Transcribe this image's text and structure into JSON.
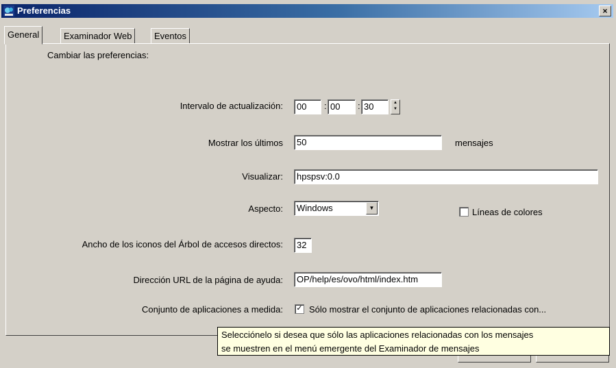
{
  "window": {
    "title": "Preferencias",
    "close_label": "×"
  },
  "tabs": [
    {
      "label": "General",
      "active": true
    },
    {
      "label": "Examinador Web",
      "active": false
    },
    {
      "label": "Eventos",
      "active": false
    }
  ],
  "general": {
    "heading": "Cambiar las preferencias:",
    "interval": {
      "label": "Intervalo de actualización:",
      "hours": "00",
      "minutes": "00",
      "seconds": "30",
      "separator": ":"
    },
    "show_last": {
      "label": "Mostrar los últimos",
      "value": "50",
      "suffix": "mensajes"
    },
    "display": {
      "label": "Visualizar:",
      "value": "hpspsv:0.0"
    },
    "appearance": {
      "label": "Aspecto:",
      "value": "Windows",
      "colored_lines_label": "Líneas de colores",
      "colored_lines_checked": false
    },
    "icon_width": {
      "label": "Ancho de los iconos del Árbol de accesos directos:",
      "value": "32"
    },
    "help_url": {
      "label": "Dirección URL de la página de ayuda:",
      "value": "OP/help/es/ovo/html/index.htm"
    },
    "custom_apps": {
      "label": "Conjunto de aplicaciones a medida:",
      "checkbox_label": "Sólo mostrar el conjunto de aplicaciones relacionadas con...",
      "checked": true
    }
  },
  "tooltip": {
    "line1": "Selecciónelo si desea que sólo las aplicaciones relacionadas con los mensajes",
    "line2": "se muestren en el menú emergente del Examinador de mensajes"
  },
  "colors": {
    "title_start": "#0a246a",
    "title_end": "#a6caf0",
    "face": "#d4d0c8",
    "tooltip_bg": "#ffffe1"
  },
  "icons": {
    "app": "openview-app-icon",
    "close": "close-icon",
    "spin": "spin-arrows-icon",
    "dropdown": "dropdown-arrow-icon",
    "check": "checkmark-icon"
  }
}
